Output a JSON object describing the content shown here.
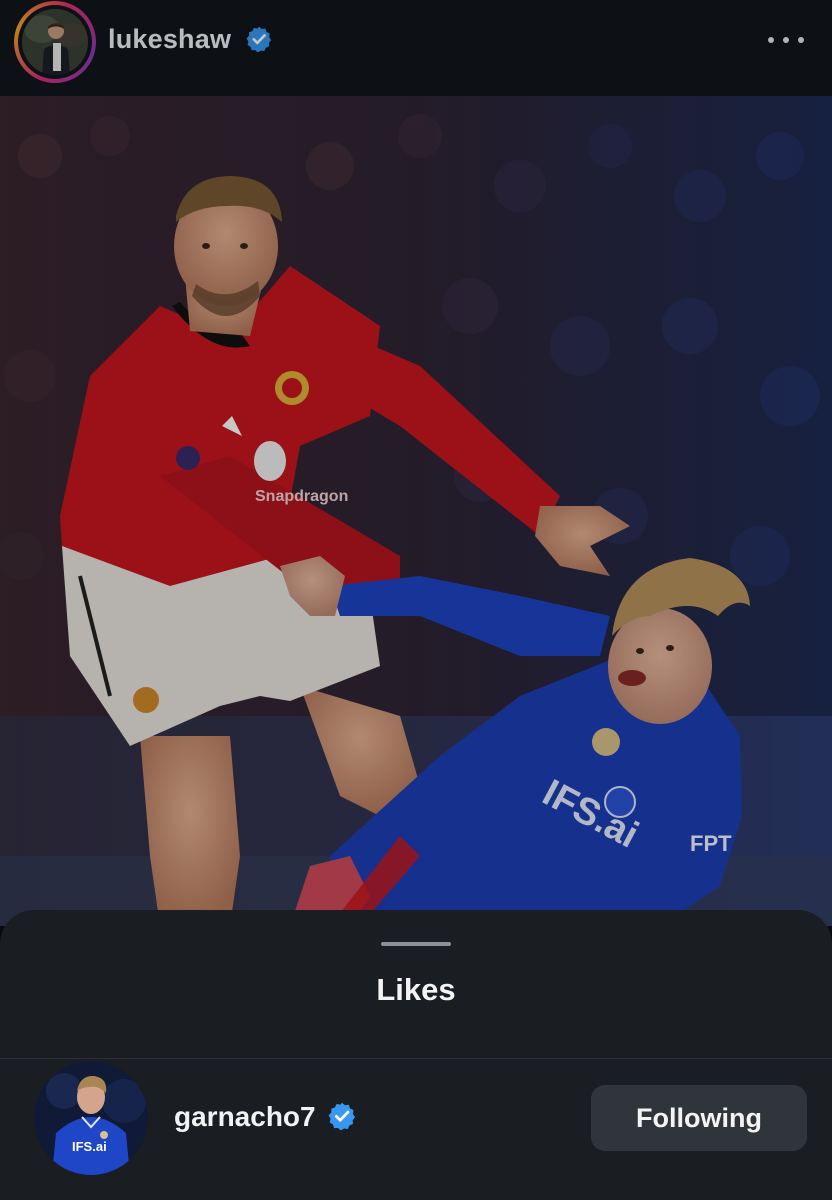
{
  "post": {
    "username": "lukeshaw",
    "verified": true,
    "avatar_icon": "profile-photo",
    "more_icon": "more-horizontal-icon"
  },
  "likes_sheet": {
    "title": "Likes",
    "users": [
      {
        "username": "garnacho7",
        "verified": true,
        "button_label": "Following",
        "avatar_jersey_text": "IFS.ai"
      }
    ]
  },
  "colors": {
    "verified_blue": "#3897f0",
    "sheet_bg": "#1a1d22",
    "button_bg": "#30343b",
    "red_kit": "#c8171f",
    "blue_kit": "#1c3fb5"
  },
  "photo": {
    "red_kit_sponsor": "Snapdragon",
    "blue_kit_sponsor": "IFS.ai",
    "blue_kit_sleeve": "FPT"
  }
}
